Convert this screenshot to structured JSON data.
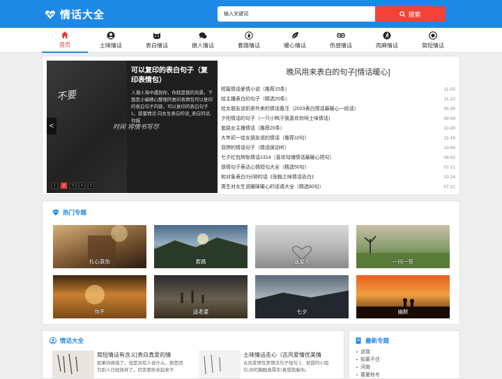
{
  "header": {
    "site_name": "情话大全",
    "search_placeholder": "输入关键词",
    "search_button": "搜索"
  },
  "nav": [
    {
      "label": "首页",
      "icon": "home-icon",
      "active": true
    },
    {
      "label": "土味情话",
      "icon": "user-icon"
    },
    {
      "label": "表白情话",
      "icon": "cat-icon"
    },
    {
      "label": "撩人情话",
      "icon": "chat-icon"
    },
    {
      "label": "套路情话",
      "icon": "fire-icon"
    },
    {
      "label": "暖心情话",
      "icon": "leaf-icon"
    },
    {
      "label": "伤感情话",
      "icon": "owl-icon"
    },
    {
      "label": "肉麻情话",
      "icon": "run-icon"
    },
    {
      "label": "简短情话",
      "icon": "target-icon"
    }
  ],
  "slider": {
    "calligraphy_1": "不要",
    "calligraphy_2": "时间  将情书写尽",
    "title": "可以复印的表白句子（复印表情包）",
    "desc": "人潮人海中遇到你，你就是我的风景。下面是小编精心整理的复印表情包可以复印的表白句子内容。可以复印的表白句子 1、甜蜜情话 向女生表白的话_表白的话, 你越",
    "prev": "<",
    "dots": [
      "1",
      "2",
      "3",
      "4",
      "5"
    ],
    "active_dot": 1
  },
  "headlines": {
    "title": "晚风用来表白的句子[情话暖心]",
    "items": [
      {
        "text": "短篇情话爱情小说（推荐15条）",
        "date": "11-05"
      },
      {
        "text": "给主播表白的句子（精选20条）",
        "date": "11-22"
      },
      {
        "text": "给女朋友说奶茶外卖的情话备注（2023表白情话最暖心一段话）",
        "date": "05-30"
      },
      {
        "text": "夕阳情话的句子（一只小鸭子我喜欢你呀土味情话）",
        "date": "09-09"
      },
      {
        "text": "套路女主播情话（推荐20条）",
        "date": "10-30"
      },
      {
        "text": "大年初一给女朋友说的情话（推荐10句）",
        "date": "11-18"
      },
      {
        "text": "双押的情话句子（情话很动听）",
        "date": "10-04"
      },
      {
        "text": "七夕红包转账情话1314（喜欢勾魂情话最暖心短句）",
        "date": "09-02"
      },
      {
        "text": "感情句子表达心情短句大全（精选50句）",
        "date": "07-21"
      },
      {
        "text": "和对象表白3分钟的话《张翰土味情话告白》",
        "date": "10-24"
      },
      {
        "text": "男生对女生说暖昧暖心的话语大全（精选80句）",
        "date": "07-21"
      }
    ]
  },
  "topics": {
    "title": "热门专题",
    "tiles": [
      "扎心哀伤",
      "套路",
      "送爱人",
      "一问一答",
      "你不",
      "送老婆",
      "七夕",
      "幽默"
    ]
  },
  "bottom": {
    "left_title": "情话大全",
    "articles": [
      {
        "title": "简短情话有含义[表白真爱的情",
        "desc": "如果你做错了，但是没有人说什么，那是因为别人已经放弃了。欣赏那些亲起来不"
      },
      {
        "title": "土味情话走心（古风爱情优美情",
        "desc": "古风爱情优美情话句子短句 1、很甜的小短句,你的胸膛真厚实!真想抱着你。"
      }
    ],
    "right_title": "最新专题",
    "new_items": [
      "说我",
      "知莱不住",
      "河南",
      "春夏秋冬"
    ]
  },
  "colors": {
    "brand_blue": "#1e88e5",
    "search_red": "#f44336",
    "active_red": "#e53935"
  }
}
